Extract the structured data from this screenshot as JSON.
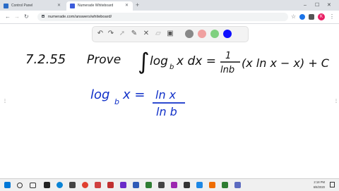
{
  "browser": {
    "tabs": [
      {
        "label": "Control Panel",
        "favicon_color": "#2a6cc8",
        "active": false
      },
      {
        "label": "Numerade Whiteboard",
        "favicon_color": "#3b5bdb",
        "active": true
      }
    ],
    "new_tab": "+",
    "address": "numerade.com/answers/whiteboard/",
    "avatar_letter": "K"
  },
  "whiteboard": {
    "tools": [
      "undo-icon",
      "redo-icon",
      "select-icon",
      "pen-icon",
      "tools-icon",
      "eraser-icon",
      "image-icon"
    ],
    "colors": [
      "#888888",
      "#f0a0a0",
      "#80d080",
      "#1010ff"
    ],
    "problem_number": "7.2.55",
    "prove_word": "Prove",
    "integrand_log": "log",
    "integrand_base": "b",
    "integrand_rest": "x dx =",
    "frac_num": "1",
    "frac_den": "lnb",
    "rhs": "(x ln x − x) + C",
    "eq2_lhs_log": "log",
    "eq2_lhs_base": "b",
    "eq2_lhs_x": "x =",
    "eq2_num": "ln x",
    "eq2_den": "ln b",
    "ink_black": "#111111",
    "ink_blue": "#1030c8"
  },
  "taskbar": {
    "time": "2:18 PM",
    "date": "6/8/2020"
  }
}
